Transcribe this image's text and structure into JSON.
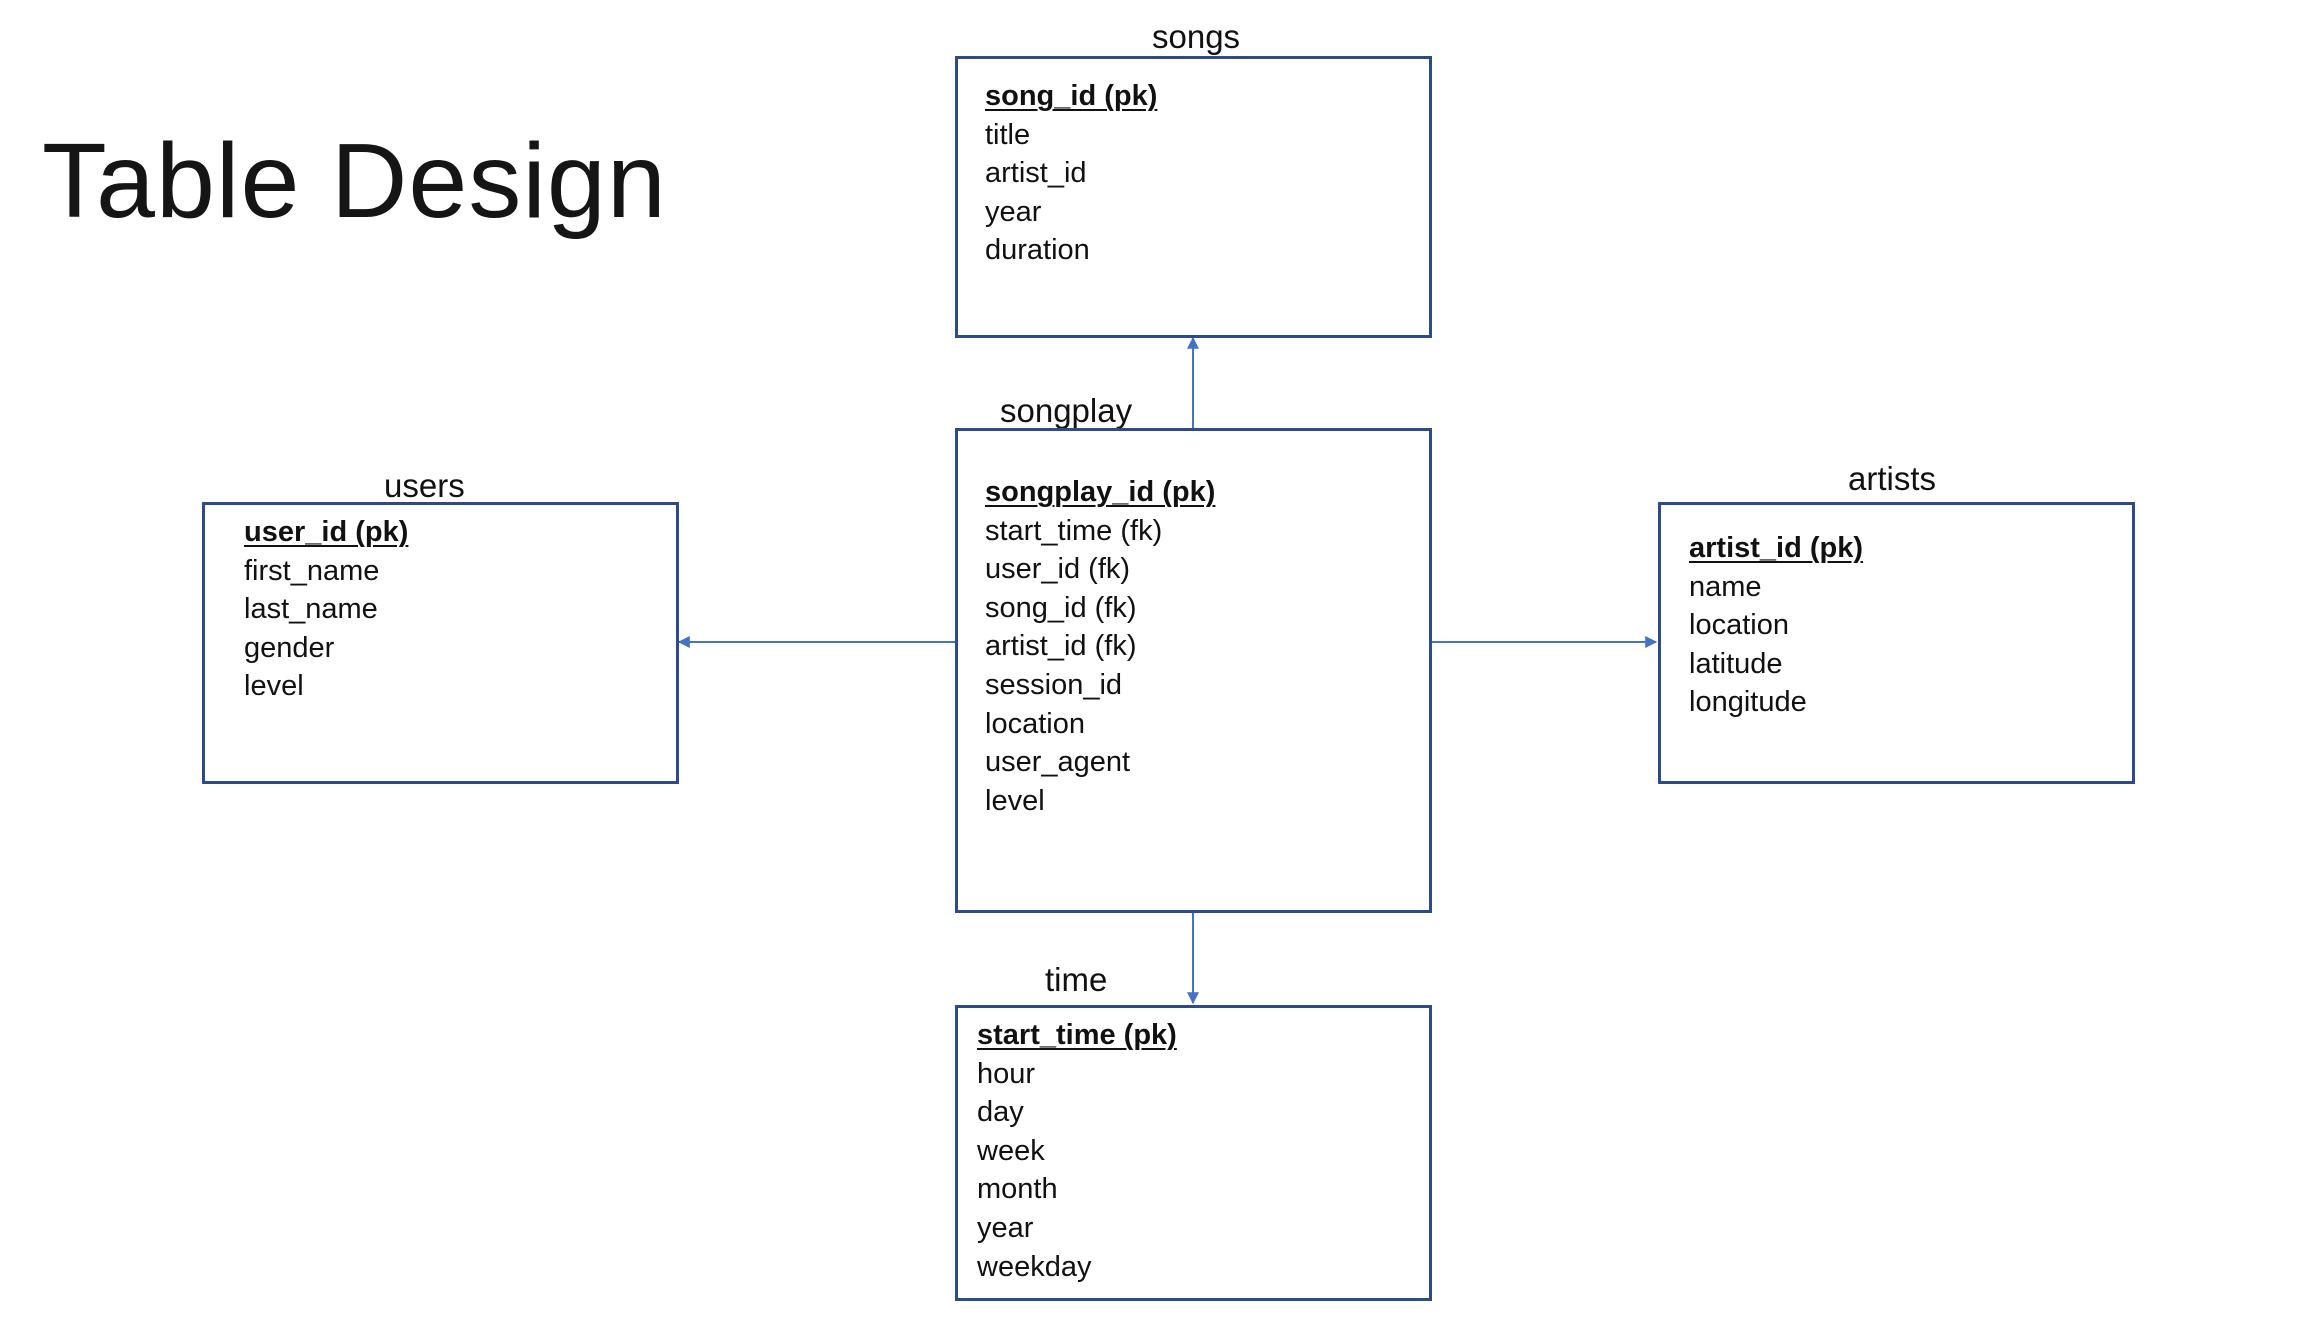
{
  "title": "Table Design",
  "colors": {
    "box_border": "#2d4a8c",
    "connector": "#4472c4"
  },
  "tables": {
    "songs": {
      "name": "songs",
      "fields": [
        "song_id (pk)",
        "title",
        "artist_id",
        "year",
        "duration"
      ]
    },
    "songplay": {
      "name": "songplay",
      "fields": [
        "songplay_id (pk)",
        "start_time (fk)",
        "user_id (fk)",
        "song_id (fk)",
        "artist_id (fk)",
        "session_id",
        "location",
        "user_agent",
        "level"
      ]
    },
    "users": {
      "name": "users",
      "fields": [
        "user_id (pk)",
        "first_name",
        "last_name",
        "gender",
        "level"
      ]
    },
    "artists": {
      "name": "artists",
      "fields": [
        "artist_id (pk)",
        "name",
        "location",
        "latitude",
        "longitude"
      ]
    },
    "time": {
      "name": "time",
      "fields": [
        "start_time (pk)",
        "hour",
        "day",
        "week",
        "month",
        "year",
        "weekday"
      ]
    }
  },
  "relationships": [
    {
      "from": "songplay",
      "to": "songs"
    },
    {
      "from": "songplay",
      "to": "users"
    },
    {
      "from": "songplay",
      "to": "artists"
    },
    {
      "from": "songplay",
      "to": "time"
    }
  ]
}
